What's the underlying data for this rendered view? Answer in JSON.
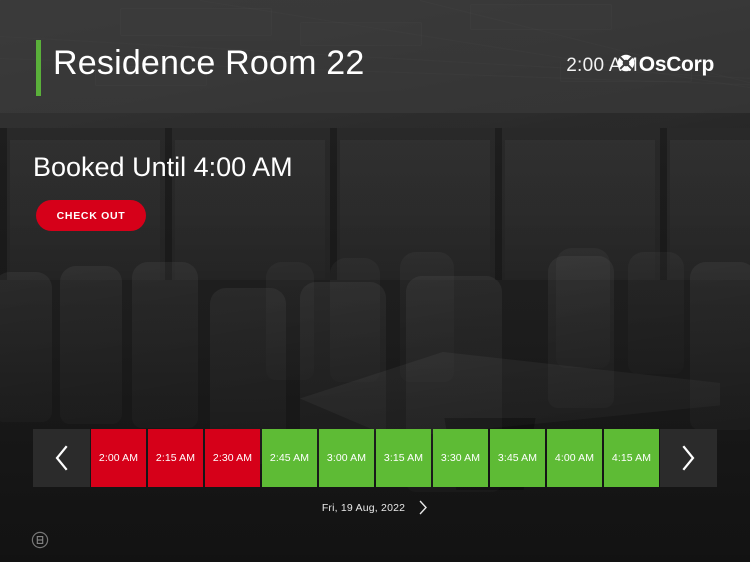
{
  "header": {
    "room_title": "Residence Room 22",
    "current_time": "2:00 AM",
    "brand_name": "OsCorp",
    "brand_icon": "lifebuoy-icon",
    "accent_color": "#5ab03a"
  },
  "status": {
    "headline": "Booked Until 4:00 AM",
    "checkout_label": "CHECK OUT",
    "checkout_color": "#d60019"
  },
  "timeline": {
    "prev_icon": "chevron-left-icon",
    "next_icon": "chevron-right-icon",
    "busy_color": "#d60019",
    "free_color": "#5ebb35",
    "slots": [
      {
        "time": "2:00 AM",
        "state": "busy"
      },
      {
        "time": "2:15 AM",
        "state": "busy"
      },
      {
        "time": "2:30 AM",
        "state": "busy"
      },
      {
        "time": "2:45 AM",
        "state": "free"
      },
      {
        "time": "3:00 AM",
        "state": "free"
      },
      {
        "time": "3:15 AM",
        "state": "free"
      },
      {
        "time": "3:30 AM",
        "state": "free"
      },
      {
        "time": "3:45 AM",
        "state": "free"
      },
      {
        "time": "4:00 AM",
        "state": "free"
      },
      {
        "time": "4:15 AM",
        "state": "free"
      }
    ]
  },
  "date_bar": {
    "date_label": "Fri, 19 Aug, 2022",
    "next_icon": "chevron-right-icon"
  },
  "footer": {
    "badge_icon": "circle-b-icon"
  }
}
